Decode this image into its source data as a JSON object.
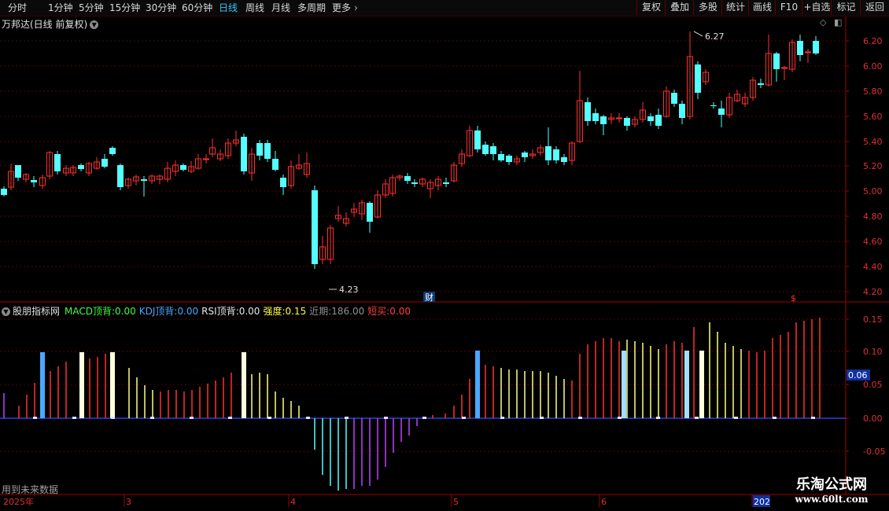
{
  "toolbar": {
    "periods": [
      "分时",
      "1分钟",
      "5分钟",
      "15分钟",
      "30分钟",
      "60分钟",
      "日线",
      "周线",
      "月线",
      "多周期",
      "更多"
    ],
    "selected_period": "日线",
    "right_buttons": [
      "复权",
      "叠加",
      "多股",
      "统计",
      "画线",
      "F10",
      "+自选",
      "标记",
      "返回"
    ]
  },
  "chart_title": "万邦达(日线 前复权)",
  "price_axis": [
    "6.20",
    "6.00",
    "5.80",
    "5.60",
    "5.40",
    "5.20",
    "5.00",
    "4.80",
    "4.60",
    "4.40",
    "4.20"
  ],
  "price_high_label": "6.27",
  "price_low_label": "4.23",
  "marker_cai": "财",
  "marker_dollar": "$",
  "indicator": {
    "name": "股朋指标网",
    "macd_label": "MACD顶背:",
    "macd_value": "0.00",
    "kdj_label": "KDJ顶背:",
    "kdj_value": "0.00",
    "rsi_label": "RSI顶背:",
    "rsi_value": "0.00",
    "strength_label": "强度:",
    "strength_value": "0.15",
    "recent_label": "近期:",
    "recent_value": "186.00",
    "short_label": "短买:",
    "short_value": "0.00"
  },
  "indicator_axis": [
    "0.15",
    "0.10",
    "0.05",
    "0.00",
    "-0.05"
  ],
  "indicator_current": "0.06",
  "future_note": "用到未来数据",
  "date_axis": [
    "2025年",
    "3",
    "4",
    "5",
    "6",
    "202"
  ],
  "watermark": {
    "line1": "乐淘公式网",
    "line2": "www.60lt.com"
  },
  "colors": {
    "up": "#ff3030",
    "down": "#54ffff",
    "grid": "#5a0000",
    "axis": "#a00000",
    "zero": "#3050ff"
  }
}
